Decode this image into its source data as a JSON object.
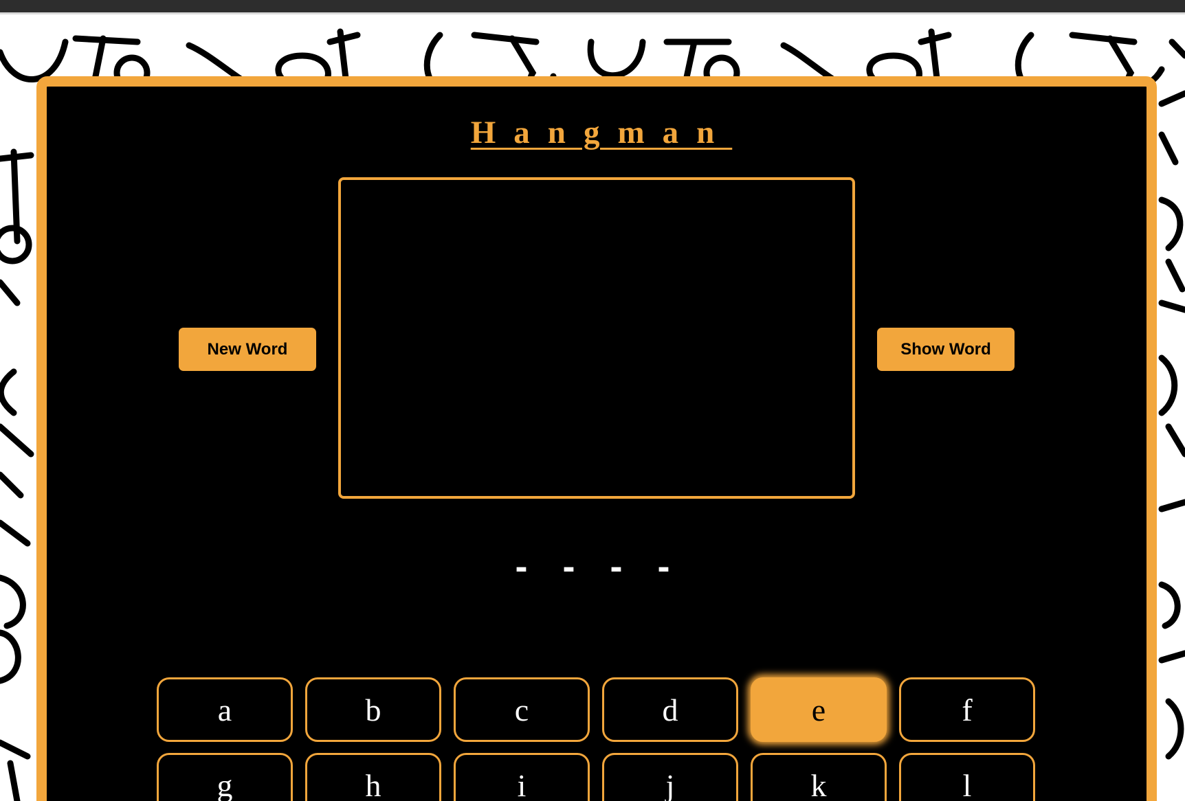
{
  "title": "Hangman",
  "buttons": {
    "new_word": "New Word",
    "show_word": "Show Word"
  },
  "word_display": "- - - -",
  "keyboard": {
    "active_key": "e",
    "keys": [
      "a",
      "b",
      "c",
      "d",
      "e",
      "f",
      "g",
      "h",
      "i",
      "j",
      "k",
      "l"
    ]
  },
  "colors": {
    "accent": "#f2a63c",
    "panel": "#000000",
    "text": "#ffffff"
  }
}
